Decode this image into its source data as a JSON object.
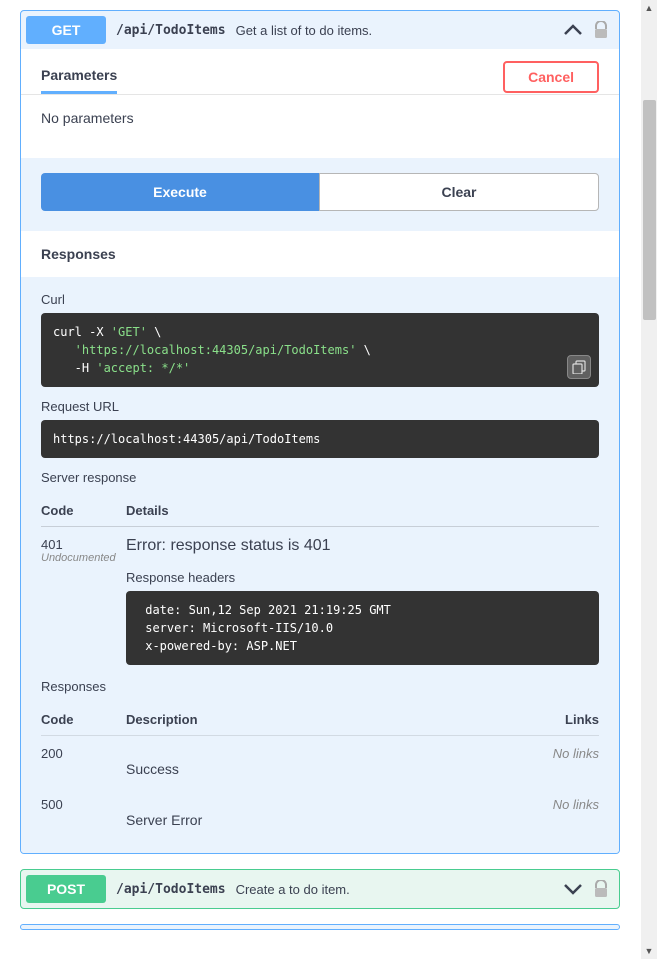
{
  "getBlock": {
    "method": "GET",
    "path": "/api/TodoItems",
    "desc": "Get a list of to do items.",
    "tab": "Parameters",
    "cancel": "Cancel",
    "noParams": "No parameters",
    "executeBtn": "Execute",
    "clearBtn": "Clear",
    "responsesHeader": "Responses",
    "curlLabel": "Curl",
    "curl": {
      "l1a": "curl -X ",
      "l1b": "'GET'",
      "l1c": " \\",
      "l2": "   'https://localhost:44305/api/TodoItems'",
      "l2b": " \\",
      "l3a": "   -H ",
      "l3b": "'accept: */*'"
    },
    "reqUrlLabel": "Request URL",
    "reqUrl": "https://localhost:44305/api/TodoItems",
    "serverRespLabel": "Server response",
    "codeHeader": "Code",
    "detailsHeader": "Details",
    "descHeader": "Description",
    "linksHeader": "Links",
    "serverResp": {
      "code": "401",
      "undoc": "Undocumented",
      "errorMsg": "Error: response status is 401",
      "headersLabel": "Response headers",
      "headers": " date: Sun,12 Sep 2021 21:19:25 GMT \n server: Microsoft-IIS/10.0 \n x-powered-by: ASP.NET "
    },
    "respSub": "Responses",
    "documented": [
      {
        "code": "200",
        "desc": "Success",
        "links": "No links"
      },
      {
        "code": "500",
        "desc": "Server Error",
        "links": "No links"
      }
    ]
  },
  "postBlock": {
    "method": "POST",
    "path": "/api/TodoItems",
    "desc": "Create a to do item."
  }
}
